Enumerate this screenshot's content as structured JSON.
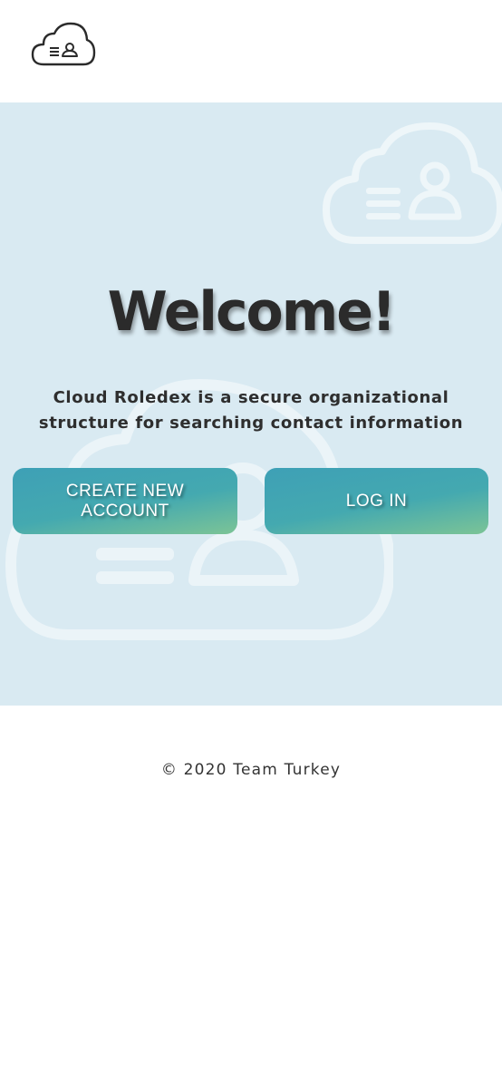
{
  "header": {
    "logo_icon": "cloud-contact-icon"
  },
  "hero": {
    "background_color": "#d9eaf2",
    "title": "Welcome!",
    "tagline_line1": "Cloud Roledex is a secure organizational",
    "tagline_line2": "structure for searching contact information",
    "decorative_icons": [
      "cloud-contact-icon",
      "cloud-contact-icon"
    ]
  },
  "actions": {
    "create_account_label": "CREATE NEW ACCOUNT",
    "login_label": "LOG IN",
    "gradient_start": "#3ea0b6",
    "gradient_end": "#7cc496"
  },
  "footer": {
    "copyright": "© 2020 Team Turkey"
  }
}
